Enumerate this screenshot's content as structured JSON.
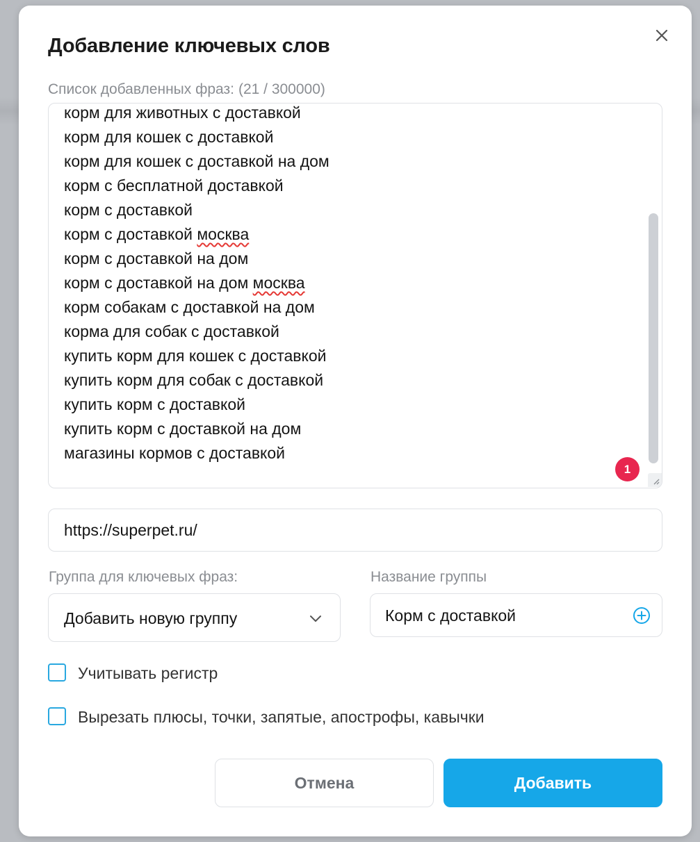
{
  "dialog": {
    "title": "Добавление ключевых слов",
    "close_icon": "close-icon"
  },
  "phrases": {
    "label": "Список добавленных фраз:",
    "count": "(21 / 300000)",
    "items": [
      {
        "text": "корм для животных с доставкой"
      },
      {
        "text": "корм для кошек с доставкой"
      },
      {
        "text": "корм для кошек с доставкой на дом"
      },
      {
        "text": "корм с бесплатной доставкой"
      },
      {
        "text": "корм с доставкой"
      },
      {
        "text": "корм с доставкой ",
        "misspelled": "москва"
      },
      {
        "text": "корм с доставкой на дом"
      },
      {
        "text": "корм с доставкой на дом ",
        "misspelled": "москва"
      },
      {
        "text": "корм собакам с доставкой на дом"
      },
      {
        "text": "корма для собак с доставкой"
      },
      {
        "text": "купить корм для кошек с доставкой"
      },
      {
        "text": "купить корм для собак с доставкой"
      },
      {
        "text": "купить корм с доставкой"
      },
      {
        "text": "купить корм с доставкой на дом"
      },
      {
        "text": "магазины кормов с доставкой"
      }
    ],
    "badge": "1",
    "scroll_fraction": 0.55
  },
  "url": {
    "value": "https://superpet.ru/"
  },
  "group": {
    "label": "Группа для ключевых фраз:",
    "selected": "Добавить новую группу",
    "icon": "chevron-down-icon"
  },
  "group_name": {
    "label": "Название группы",
    "value": "Корм с доставкой",
    "icon": "plus-circle-icon"
  },
  "options": {
    "case_sensitive": {
      "label": "Учитывать регистр",
      "checked": false
    },
    "strip_punctuation": {
      "label": "Вырезать плюсы, точки, запятые, апострофы, кавычки",
      "checked": false
    }
  },
  "actions": {
    "cancel_label": "Отмена",
    "add_label": "Добавить"
  },
  "colors": {
    "accent": "#16a7e8",
    "badge": "#e8264f",
    "checkbox_border": "#29a8e0"
  }
}
